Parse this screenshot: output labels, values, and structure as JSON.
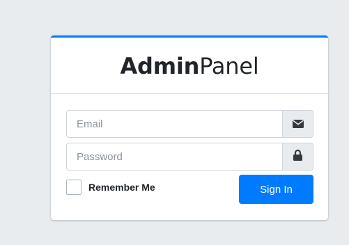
{
  "login": {
    "logo_bold": "Admin",
    "logo_light": "Panel",
    "email": {
      "placeholder": "Email",
      "value": "",
      "icon": "envelope-icon"
    },
    "password": {
      "placeholder": "Password",
      "value": "",
      "icon": "lock-icon"
    },
    "remember_label": "Remember Me",
    "remember_checked": false,
    "submit_label": "Sign In"
  },
  "colors": {
    "page_background": "#e9ecef",
    "accent": "#007bff",
    "icon": "#343a40"
  }
}
